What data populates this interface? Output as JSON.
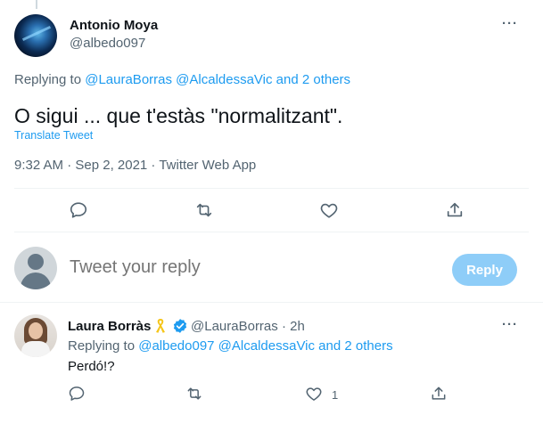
{
  "tweet": {
    "author": {
      "name": "Antonio Moya",
      "handle": "@albedo097"
    },
    "replying": {
      "prefix": "Replying to",
      "mentions": "@LauraBorras @AlcaldessaVic and 2 others"
    },
    "text": "O sigui ... que t'estàs \"normalitzant\".",
    "translate_label": "Translate Tweet",
    "meta": "9:32 AM · Sep 2, 2021 · Twitter Web App",
    "more_label": "···"
  },
  "compose": {
    "placeholder": "Tweet your reply",
    "button_label": "Reply"
  },
  "reply": {
    "author": {
      "name": "Laura Borràs",
      "handle_time": "@LauraBorras · 2h"
    },
    "replying": {
      "prefix": "Replying to",
      "mentions": "@albedo097 @AlcaldessaVic and 2 others"
    },
    "text": "Perdó!?",
    "like_count": "1",
    "more_label": "···"
  },
  "colors": {
    "accent": "#1d9bf0",
    "muted": "#536471",
    "reply_button_disabled": "#8ecdf8",
    "ribbon": "#f5c518"
  }
}
